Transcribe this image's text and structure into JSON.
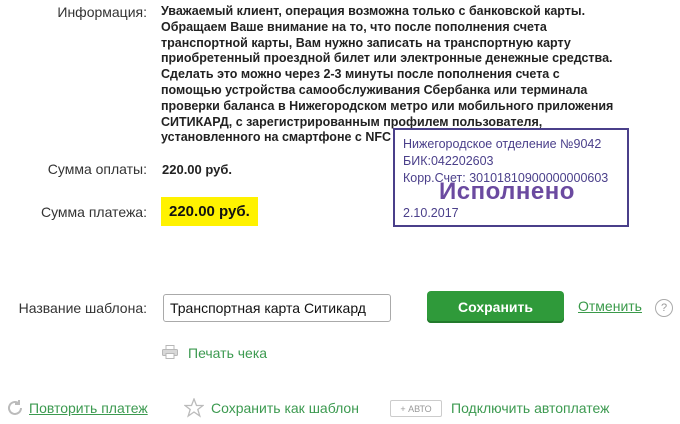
{
  "info": {
    "label": "Информация:",
    "text": "Уважаемый клиент, операция возможна только с банковской карты. Обращаем Ваше внимание на то, что после пополнения счета транспортной карты, Вам нужно записать на транспортную карту приобретенный проездной билет или электронные денежные средства. Сделать это можно через 2-3 минуты после пополнения счета с помощью устройства самообслуживания Сбербанка или терминала проверки баланса в Нижегородском метро или мобильного приложения СИТИКАРД, с зарегистрированным профилем пользователя, установленного на смартфоне с NFC"
  },
  "payment_amount": {
    "label": "Сумма оплаты:",
    "value": "220.00 руб."
  },
  "total_amount": {
    "label": "Сумма платежа:",
    "value": "220.00 руб."
  },
  "stamp": {
    "branch": "Нижегородское отделение №9042",
    "bik": "БИК:042202603",
    "account": "Корр.Счет: 30101810900000000603",
    "status": "Исполнено",
    "date": "2.10.2017"
  },
  "template": {
    "label": "Название шаблона:",
    "value": "Транспортная карта Ситикард",
    "save_label": "Сохранить",
    "cancel_label": "Отменить",
    "help": "?"
  },
  "print_label": "Печать чека",
  "bottom_actions": {
    "repeat": "Повторить платеж",
    "save_template": "Сохранить как шаблон",
    "auto_badge": "+ АВТО",
    "autopay": "Подключить автоплатеж"
  },
  "colors": {
    "accent_green": "#2f9a3a",
    "link_green": "#3c9a50",
    "stamp_purple": "#4a3f8a",
    "highlight": "#fff200"
  }
}
